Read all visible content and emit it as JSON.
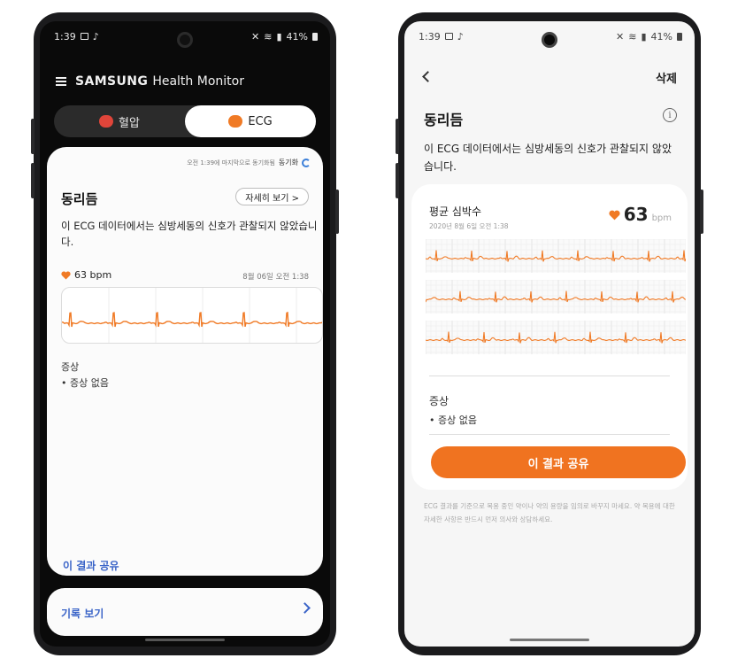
{
  "colors": {
    "accent_orange": "#f07320",
    "ecg_line": "#f07a25",
    "link_blue": "#3a64c8",
    "sync_blue": "#3a7ed8",
    "blood_pressure_red": "#e0453a"
  },
  "left_phone": {
    "status": {
      "time": "1:39",
      "battery": "41%"
    },
    "header": {
      "brand": "SAMSUNG",
      "brand_sub": "Health Monitor",
      "menu_icon": "hamburger-icon"
    },
    "tabs": [
      {
        "label": "혈압",
        "icon": "blood-pressure-heart-icon",
        "selected": false
      },
      {
        "label": "ECG",
        "icon": "ecg-heart-icon",
        "selected": true
      }
    ],
    "sync": {
      "text": "오전 1:39에 마지막으로 동기화됨",
      "label": "동기화"
    },
    "result": {
      "title": "동리듬",
      "detail_button": "자세히 보기 >",
      "description": "이 ECG 데이터에서는 심방세동의 신호가 관찰되지 않았습니다.",
      "bpm": "63 bpm",
      "date": "8월 06일 오전 1:38"
    },
    "symptoms": {
      "heading": "증상",
      "items": [
        "• 증상 없음"
      ]
    },
    "share_link": "이 결과 공유",
    "records": "기록 보기"
  },
  "right_phone": {
    "status": {
      "time": "1:39",
      "battery": "41%"
    },
    "toolbar": {
      "delete": "삭제"
    },
    "title": "동리듬",
    "description": "이 ECG 데이터에서는 심방세동의 신호가 관찰되지 않았습니다.",
    "avg": {
      "label": "평균 심박수",
      "date": "2020년 8월 6일 오전 1:38",
      "value": "63",
      "unit": "bpm"
    },
    "symptoms": {
      "heading": "증상",
      "items": [
        "• 증상 없음"
      ]
    },
    "share_button": "이 결과 공유",
    "disclaimer": "ECG 결과를 기준으로 복용 중인 약이나 약의 용량을 임의로 바꾸지 마세요. 약 복용에 대한 자세한 사항은 반드시 먼저 의사와 상담하세요."
  }
}
